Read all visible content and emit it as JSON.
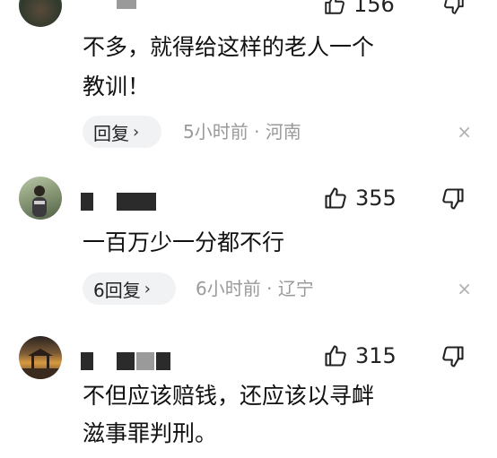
{
  "comments": [
    {
      "like_count": "156",
      "text_lines": [
        "不多，就得给这样的老人一个",
        "教训！"
      ],
      "reply_label": "回复",
      "time": "5小时前",
      "location": "河南",
      "meta_sep": " · "
    },
    {
      "like_count": "355",
      "text_lines": [
        "一百万少一分都不行"
      ],
      "reply_label": "6回复",
      "time": "6小时前",
      "location": "辽宁",
      "meta_sep": " · "
    },
    {
      "like_count": "315",
      "text_lines": [
        "不但应该赔钱，还应该以寻衅",
        "滋事罪判刑。"
      ]
    }
  ],
  "icons": {
    "like": "thumbs-up-icon",
    "dislike": "thumbs-down-icon",
    "close": "close-icon",
    "chevron": "chevron-right-icon"
  },
  "colors": {
    "reply_bg": "#f1f2f4",
    "meta_text": "#9a9a9a",
    "redaction": "#2b2b2b"
  },
  "symbols": {
    "chevron": "›",
    "close": "×"
  }
}
